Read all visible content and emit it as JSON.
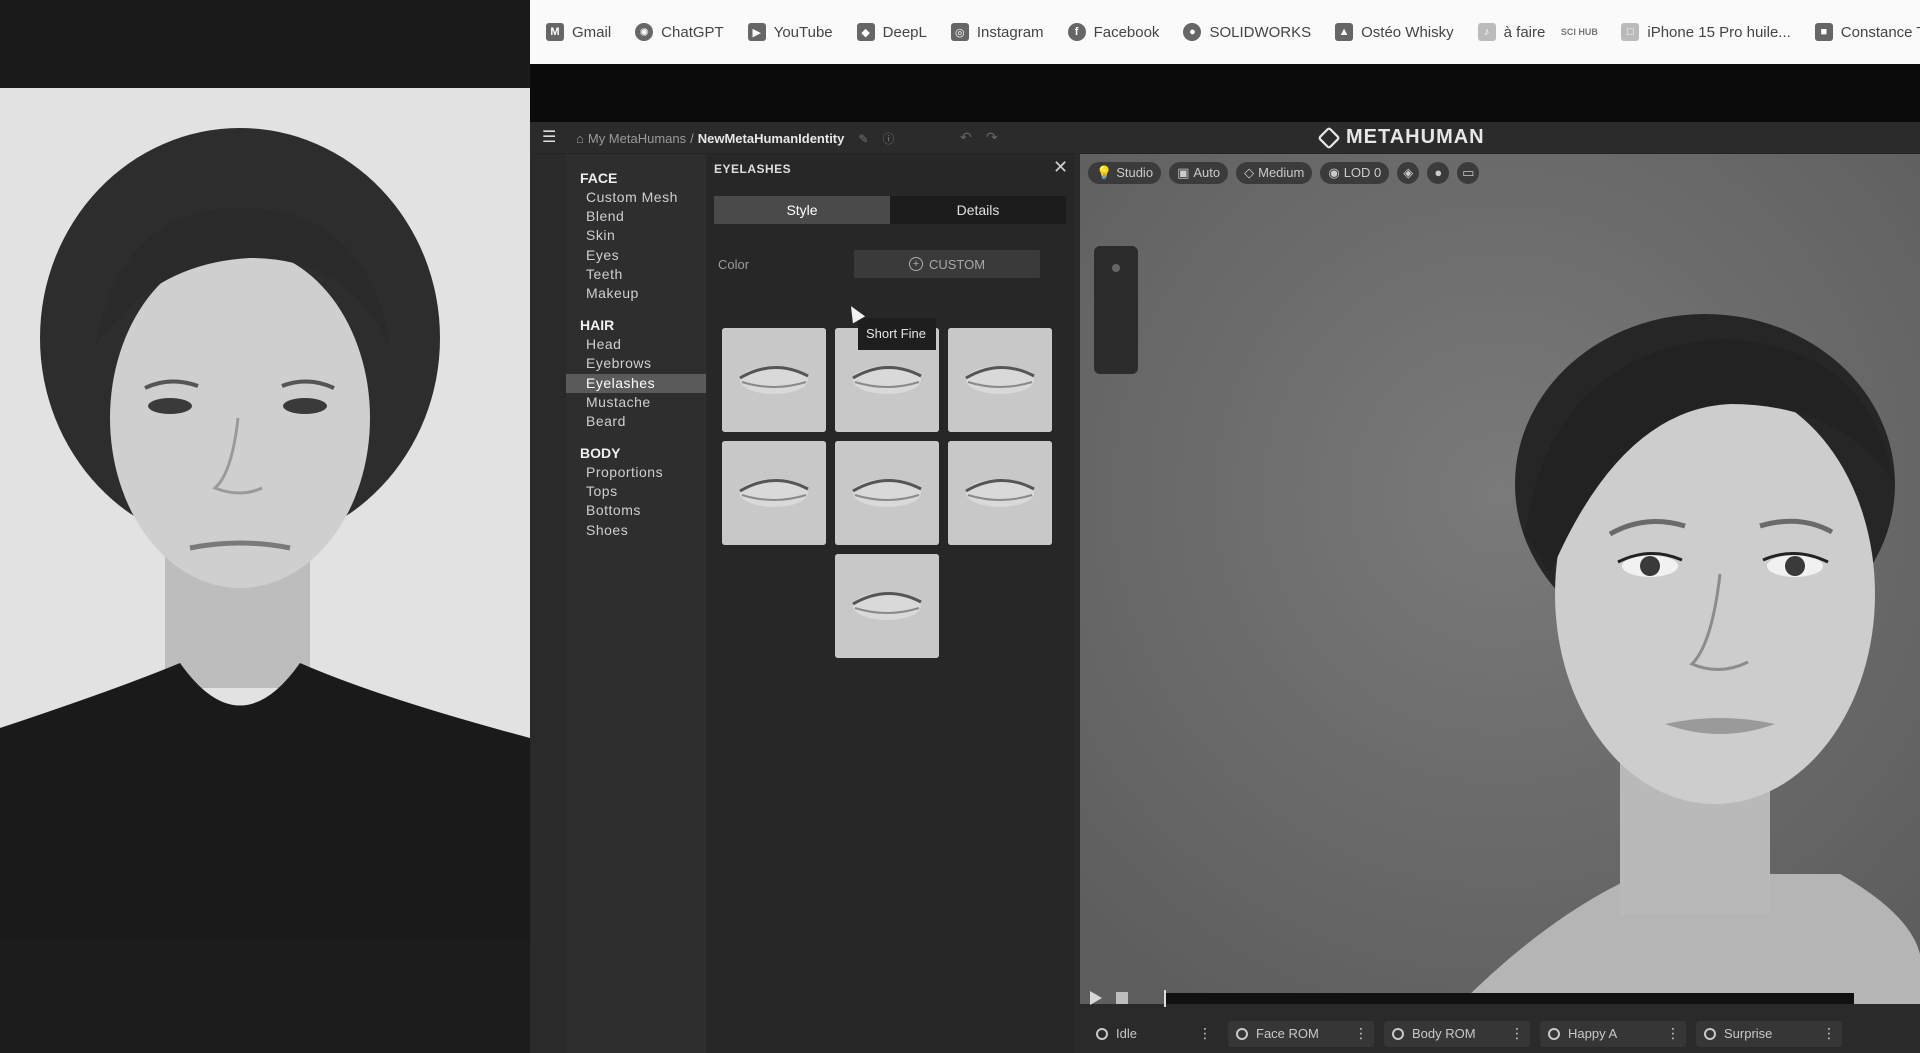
{
  "bookmarks": [
    {
      "label": "Gmail",
      "icon": "gmail-icon",
      "glyph": "M"
    },
    {
      "label": "ChatGPT",
      "icon": "chatgpt-icon",
      "glyph": "✺"
    },
    {
      "label": "YouTube",
      "icon": "youtube-icon",
      "glyph": "▶"
    },
    {
      "label": "DeepL",
      "icon": "deepl-icon",
      "glyph": "◆"
    },
    {
      "label": "Instagram",
      "icon": "instagram-icon",
      "glyph": "◎"
    },
    {
      "label": "Facebook",
      "icon": "facebook-icon",
      "glyph": "f"
    },
    {
      "label": "SOLIDWORKS",
      "icon": "solidworks-icon",
      "glyph": "●"
    },
    {
      "label": "Ostéo Whisky",
      "icon": "osteo-whisky-icon",
      "glyph": "▲"
    },
    {
      "label": "à faire",
      "icon": "a-faire-icon",
      "glyph": "♪"
    },
    {
      "label": "",
      "icon": "sci-hub-icon",
      "glyph": "SCI HUB"
    },
    {
      "label": "iPhone 15 Pro huile...",
      "icon": "iphone-icon",
      "glyph": "□"
    },
    {
      "label": "Constance Th",
      "icon": "constance-avatar-icon",
      "glyph": "■"
    }
  ],
  "header": {
    "crumb_root": "My MetaHumans",
    "crumb_sep": "/",
    "crumb_current": "NewMetaHumanIdentity",
    "logo_text": "METAHUMAN"
  },
  "nav": {
    "face": {
      "title": "FACE",
      "items": [
        "Custom Mesh",
        "Blend",
        "Skin",
        "Eyes",
        "Teeth",
        "Makeup"
      ]
    },
    "hair": {
      "title": "HAIR",
      "items": [
        "Head",
        "Eyebrows",
        "Eyelashes",
        "Mustache",
        "Beard"
      ],
      "active": "Eyelashes"
    },
    "body": {
      "title": "BODY",
      "items": [
        "Proportions",
        "Tops",
        "Bottoms",
        "Shoes"
      ]
    }
  },
  "panel": {
    "title": "EYELASHES",
    "close": "✕",
    "tabs": [
      "Style",
      "Details"
    ],
    "active_tab": "Style",
    "color_label": "Color",
    "custom_label": "CUSTOM",
    "tooltip": "Short Fine",
    "thumb_count": 7
  },
  "viewport": {
    "toolbar": [
      "Studio",
      "Auto",
      "Medium",
      "LOD 0"
    ]
  },
  "animations": [
    "Idle",
    "Face ROM",
    "Body ROM",
    "Happy A",
    "Surprise"
  ],
  "colors": {
    "app_bg": "#2a2a2a",
    "nav_active": "#5a5a5a",
    "viewport_bg": "#6e6e6e"
  }
}
